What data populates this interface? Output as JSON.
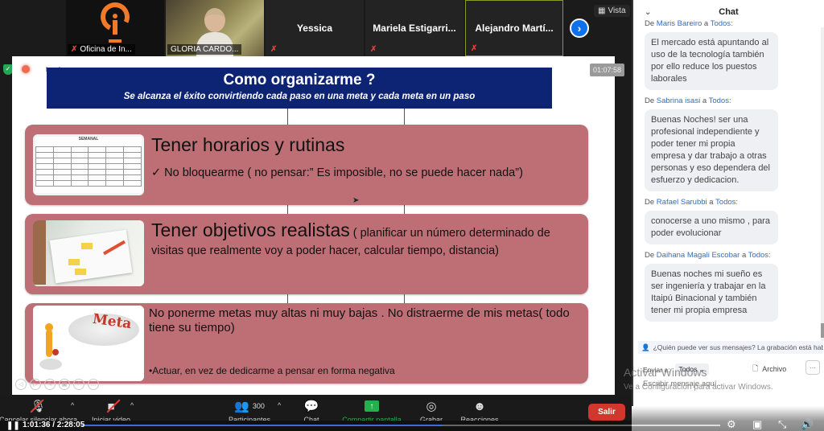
{
  "participants": [
    {
      "name": "Oficina de In...",
      "type": "logo",
      "muted": true
    },
    {
      "name": "GLORIA CARDO...",
      "type": "video",
      "muted": false
    },
    {
      "name": "Yessica",
      "type": "name",
      "muted": true
    },
    {
      "name": "Mariela  Estigarri...",
      "type": "name",
      "muted": true
    },
    {
      "name": "Alejandro  Martí...",
      "type": "name",
      "muted": true,
      "active": true
    }
  ],
  "view_button": "Vista",
  "next_icon": "chevron-right",
  "slide": {
    "recording_label": "bando",
    "timer": "01:07:58",
    "title": "Como organizarme ?",
    "subtitle": "Se alcanza el éxito convirtiendo cada paso en una meta y cada meta en un paso",
    "rows": [
      {
        "heading": "Tener horarios y rutinas",
        "bullet": "✓  No bloquearme ( no pensar:” Es imposible, no se puede hacer nada”)",
        "image": "weekly-schedule",
        "schedule_header": "SEMANAL",
        "schedule_days": [
          "LUNES",
          "MARTES",
          "MIÉRCOLES",
          "JUEVES",
          "VIERNES"
        ]
      },
      {
        "heading": "Tener objetivos realistas",
        "detail": " ( planificar un número determinado de visitas que realmente voy a poder hacer, calcular tiempo, distancia)",
        "image": "planner-writing"
      },
      {
        "text": "No ponerme metas muy altas ni muy bajas . No distraerme de mis metas( todo tiene su tiempo)",
        "bullet": "•Actuar, en vez de dedicarme a pensar en forma negativa",
        "image": "meta-goal",
        "image_word": "Meta"
      }
    ]
  },
  "toolbar": {
    "unmute": "Cancelar silenciar ahora",
    "video": "Iniciar video",
    "participants": "Participantes",
    "participants_count": "300",
    "chat": "Chat",
    "share": "Compartir pantalla",
    "record": "Grabar",
    "reactions": "Reacciones",
    "leave": "Salir"
  },
  "player": {
    "time": "1:01:36 / 2:28:05",
    "progress_percent": 44
  },
  "chat": {
    "title": "Chat",
    "messages": [
      {
        "from_prefix": "De ",
        "from": "Maris Bareiro",
        "to_prefix": " a ",
        "to": "Todos:",
        "text": "El mercado está apuntando al uso de la tecnología también por ello reduce los puestos laborales"
      },
      {
        "from_prefix": "De ",
        "from": "Sabrina isasi ",
        "to_prefix": " a ",
        "to": "Todos:",
        "text": "Buenas Noches! ser una profesional independiente y poder tener mi propia empresa y dar trabajo a otras personas y eso dependera del esfuerzo y dedicacion."
      },
      {
        "from_prefix": "De ",
        "from": "Rafael Sarubbi",
        "to_prefix": " a ",
        "to": "Todos:",
        "text": "conocerse a uno mismo , para poder evolucionar"
      },
      {
        "from_prefix": "De ",
        "from": "Daihana Magali Escobar",
        "to_prefix": " a ",
        "to": "Todos:",
        "text": "Buenas noches mi sueño es ser ingeniería y trabajar en la Itaipú Binacional y también tener mi propia empresa"
      }
    ],
    "privacy_notice": "¿Quién puede ver sus mensajes? La grabación está habilit",
    "send_to_label": "Enviar a:",
    "send_to_value": "Todos",
    "file_label": "Archivo",
    "more_label": "···",
    "input_placeholder": "Escribir mensaje aquí..."
  },
  "watermark": {
    "line1": "Activar Windows",
    "line2": "Ve a Configuración para activar Windows."
  }
}
